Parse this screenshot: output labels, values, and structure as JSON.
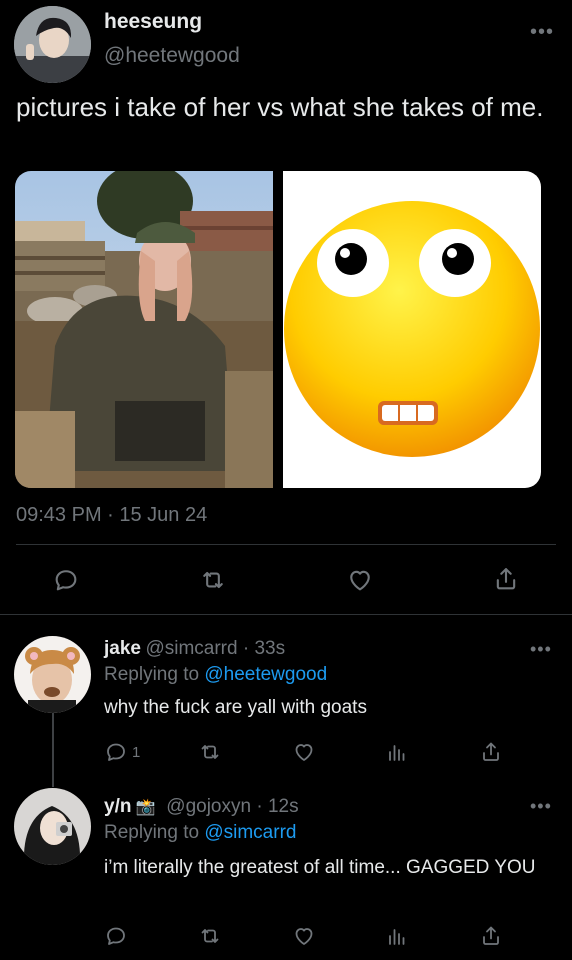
{
  "main_tweet": {
    "display_name": "heeseung",
    "handle": "@heetewgood",
    "text": "pictures i take of her vs what she takes of me.",
    "timestamp": "09:43 PM · 15 Jun 24",
    "more_label": "•••"
  },
  "replies": [
    {
      "display_name": "jake",
      "handle": "@simcarrd · 33s",
      "replying_prefix": "Replying to",
      "replying_to": "@heetewgood",
      "text": "why the fuck are yall with goats",
      "reply_count": "1",
      "more_label": "•••"
    },
    {
      "display_name": "y/n",
      "name_emoji": "📸",
      "handle": "@gojoxyn · 12s",
      "replying_prefix": "Replying to",
      "replying_to": "@simcarrd",
      "text": "i’m literally the greatest of all time... GAGGED YOU",
      "more_label": "•••"
    }
  ],
  "colors": {
    "background": "#000000",
    "text_primary": "#e7e9ea",
    "text_secondary": "#71767b",
    "link": "#1d9bf0",
    "divider": "#2f3336"
  },
  "icons": [
    "reply-icon",
    "retweet-icon",
    "like-icon",
    "share-icon",
    "views-icon",
    "more-icon"
  ]
}
